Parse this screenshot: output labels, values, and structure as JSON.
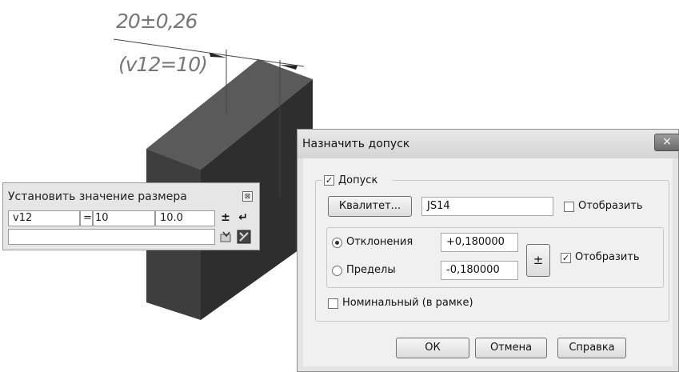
{
  "annotation": {
    "dimension_text": "20±0,26",
    "variable_text": "(v12=10)"
  },
  "dimension_panel": {
    "title": "Установить значение размера",
    "variable": "v12",
    "equals": "=",
    "value": "10",
    "computed": "10.0",
    "plusminus": "±",
    "enter_glyph": "↵"
  },
  "dialog": {
    "title": "Назначить допуск",
    "close_glyph": "×",
    "tolerance_checkbox": {
      "label": "Допуск",
      "checked": true
    },
    "qualitet_button": "Квалитет...",
    "qualitet_value": "JS14",
    "display_qualitet": {
      "label": "Отобразить",
      "checked": false
    },
    "deviations_radio": {
      "label": "Отклонения",
      "selected": true
    },
    "limits_radio": {
      "label": "Пределы",
      "selected": false
    },
    "upper_value": "+0,180000",
    "lower_value": "-0,180000",
    "plusminus_button": "±",
    "display_deviations": {
      "label": "Отобразить",
      "checked": true
    },
    "nominal_checkbox": {
      "label": "Номинальный (в рамке)",
      "checked": false
    },
    "ok_button": "ОК",
    "cancel_button": "Отмена",
    "help_button": "Справка"
  }
}
